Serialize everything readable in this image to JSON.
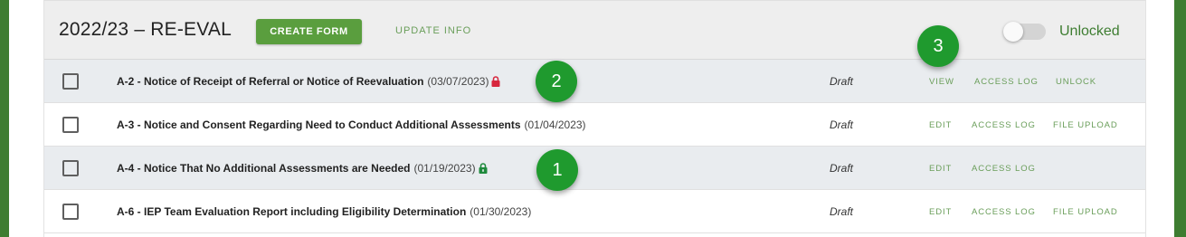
{
  "header": {
    "title": "2022/23 – RE-EVAL",
    "create_button": "CREATE FORM",
    "update_button": "UPDATE INFO",
    "toggle_label": "Unlocked",
    "toggle_on": false
  },
  "rows": [
    {
      "name": "A-2 - Notice of Receipt of Referral or Notice of Reevaluation",
      "date": "(03/07/2023)",
      "lock": "locked",
      "status": "Draft",
      "actions": [
        "VIEW",
        "ACCESS LOG",
        "UNLOCK"
      ]
    },
    {
      "name": "A-3 - Notice and Consent Regarding Need to Conduct Additional Assessments",
      "date": "(01/04/2023)",
      "lock": "none",
      "status": "Draft",
      "actions": [
        "EDIT",
        "ACCESS LOG",
        "FILE UPLOAD"
      ]
    },
    {
      "name": "A-4 - Notice That No Additional Assessments are Needed",
      "date": "(01/19/2023)",
      "lock": "unlocked",
      "status": "Draft",
      "actions": [
        "EDIT",
        "ACCESS LOG"
      ]
    },
    {
      "name": "A-6 - IEP Team Evaluation Report including Eligibility Determination",
      "date": "(01/30/2023)",
      "lock": "none",
      "status": "Draft",
      "actions": [
        "EDIT",
        "ACCESS LOG",
        "FILE UPLOAD"
      ]
    }
  ],
  "badges": [
    "3",
    "2",
    "1"
  ],
  "colors": {
    "accent_green": "#5a9e3e",
    "link_green": "#6a9e5a",
    "badge_green": "#1f9a2e",
    "lock_red": "#d7263d",
    "lock_green": "#1e8a3c",
    "frame_green": "#3e7d31"
  },
  "icons": {
    "locked": "padlock-closed-icon",
    "unlocked": "padlock-open-icon"
  }
}
